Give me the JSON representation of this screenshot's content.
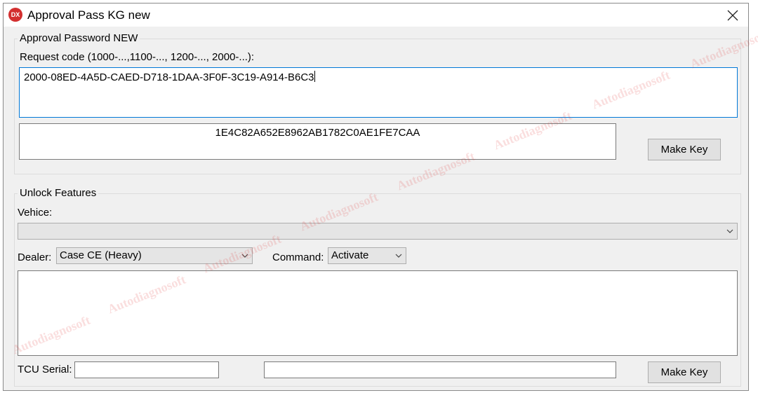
{
  "window": {
    "title": "Approval Pass KG new",
    "icon_text": "DX"
  },
  "approval": {
    "legend": "Approval Password NEW",
    "request_label": "Request code (1000-...,1100-..., 1200-..., 2000-...):",
    "request_value": "2000-08ED-4A5D-CAED-D718-1DAA-3F0F-3C19-A914-B6C3",
    "key_value": "1E4C82A652E8962AB1782C0AE1FE7CAA",
    "make_key_label": "Make Key"
  },
  "unlock": {
    "legend": "Unlock Features",
    "vehicle_label": "Vehice:",
    "vehicle_value": "",
    "dealer_label": "Dealer:",
    "dealer_value": "Case CE (Heavy)",
    "command_label": "Command:",
    "command_value": "Activate",
    "notes_value": "",
    "tcu_label": "TCU Serial:",
    "tcu_value": "",
    "result_value": "",
    "make_key_label": "Make Key"
  },
  "watermark": {
    "text": "Autodiagnosoft"
  },
  "colors": {
    "window_bg": "#f0f0f0",
    "focus_border": "#0078d7",
    "app_icon": "#d32f2f",
    "watermark": "#e13c3c"
  }
}
